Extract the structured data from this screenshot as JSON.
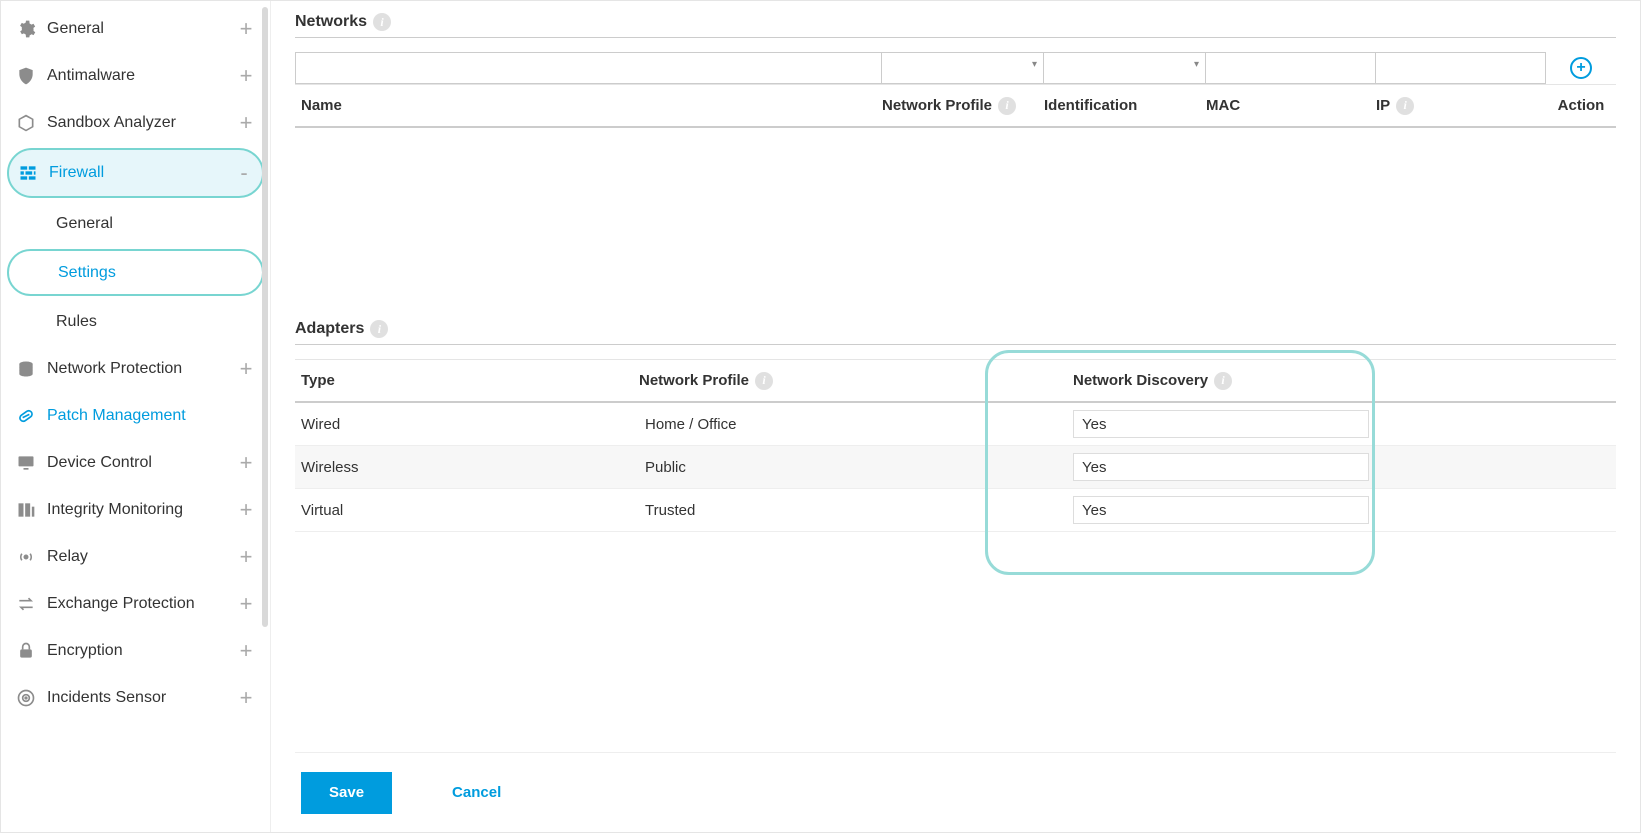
{
  "sidebar": {
    "items": [
      {
        "label": "General",
        "icon": "gear",
        "expand": "+"
      },
      {
        "label": "Antimalware",
        "icon": "shield",
        "expand": "+"
      },
      {
        "label": "Sandbox Analyzer",
        "icon": "cube",
        "expand": "+"
      },
      {
        "label": "Firewall",
        "icon": "firewall",
        "expand": "-",
        "active": true,
        "children": [
          {
            "label": "General"
          },
          {
            "label": "Settings",
            "selected": true
          },
          {
            "label": "Rules"
          }
        ]
      },
      {
        "label": "Network Protection",
        "icon": "stack",
        "expand": "+"
      },
      {
        "label": "Patch Management",
        "icon": "patch",
        "expand": "",
        "highlighted": true
      },
      {
        "label": "Device Control",
        "icon": "monitor",
        "expand": "+"
      },
      {
        "label": "Integrity Monitoring",
        "icon": "integrity",
        "expand": "+"
      },
      {
        "label": "Relay",
        "icon": "relay",
        "expand": "+"
      },
      {
        "label": "Exchange Protection",
        "icon": "exchange",
        "expand": "+"
      },
      {
        "label": "Encryption",
        "icon": "lock",
        "expand": "+"
      },
      {
        "label": "Incidents Sensor",
        "icon": "radar",
        "expand": "+"
      }
    ]
  },
  "networks": {
    "title": "Networks",
    "columns": {
      "name": "Name",
      "profile": "Network Profile",
      "identification": "Identification",
      "mac": "MAC",
      "ip": "IP",
      "action": "Action"
    }
  },
  "adapters": {
    "title": "Adapters",
    "columns": {
      "type": "Type",
      "profile": "Network Profile",
      "discovery": "Network Discovery"
    },
    "rows": [
      {
        "type": "Wired",
        "profile": "Home / Office",
        "discovery": "Yes"
      },
      {
        "type": "Wireless",
        "profile": "Public",
        "discovery": "Yes"
      },
      {
        "type": "Virtual",
        "profile": "Trusted",
        "discovery": "Yes"
      }
    ]
  },
  "footer": {
    "save": "Save",
    "cancel": "Cancel"
  }
}
